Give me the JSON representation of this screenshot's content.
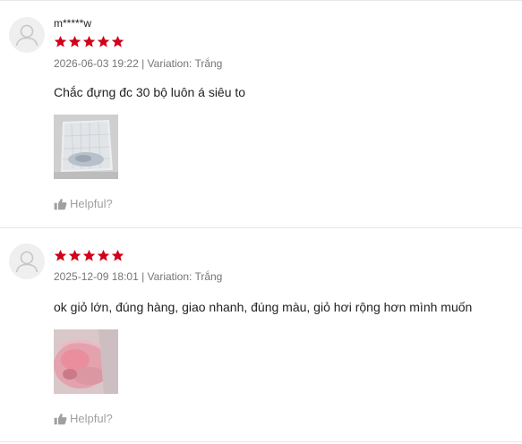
{
  "reviews": [
    {
      "username": "m*****w",
      "rating": 5,
      "meta": "2026-06-03 19:22 | Variation: Trắng",
      "comment": "Chắc đựng đc 30 bộ luôn á siêu to",
      "helpful_label": "Helpful?"
    },
    {
      "rating": 5,
      "meta": "2025-12-09 18:01 | Variation: Trắng",
      "comment": "ok giỏ lớn, đúng hàng, giao nhanh, đúng màu, giỏ hơi rộng hơn mình muốn",
      "helpful_label": "Helpful?"
    }
  ],
  "colors": {
    "star": "#d0011b",
    "meta_text": "#757575",
    "helpful_text": "#a0a0a0"
  },
  "icons": {
    "avatar": "user-avatar-icon",
    "star": "star-icon",
    "helpful": "thumbs-up-icon"
  }
}
